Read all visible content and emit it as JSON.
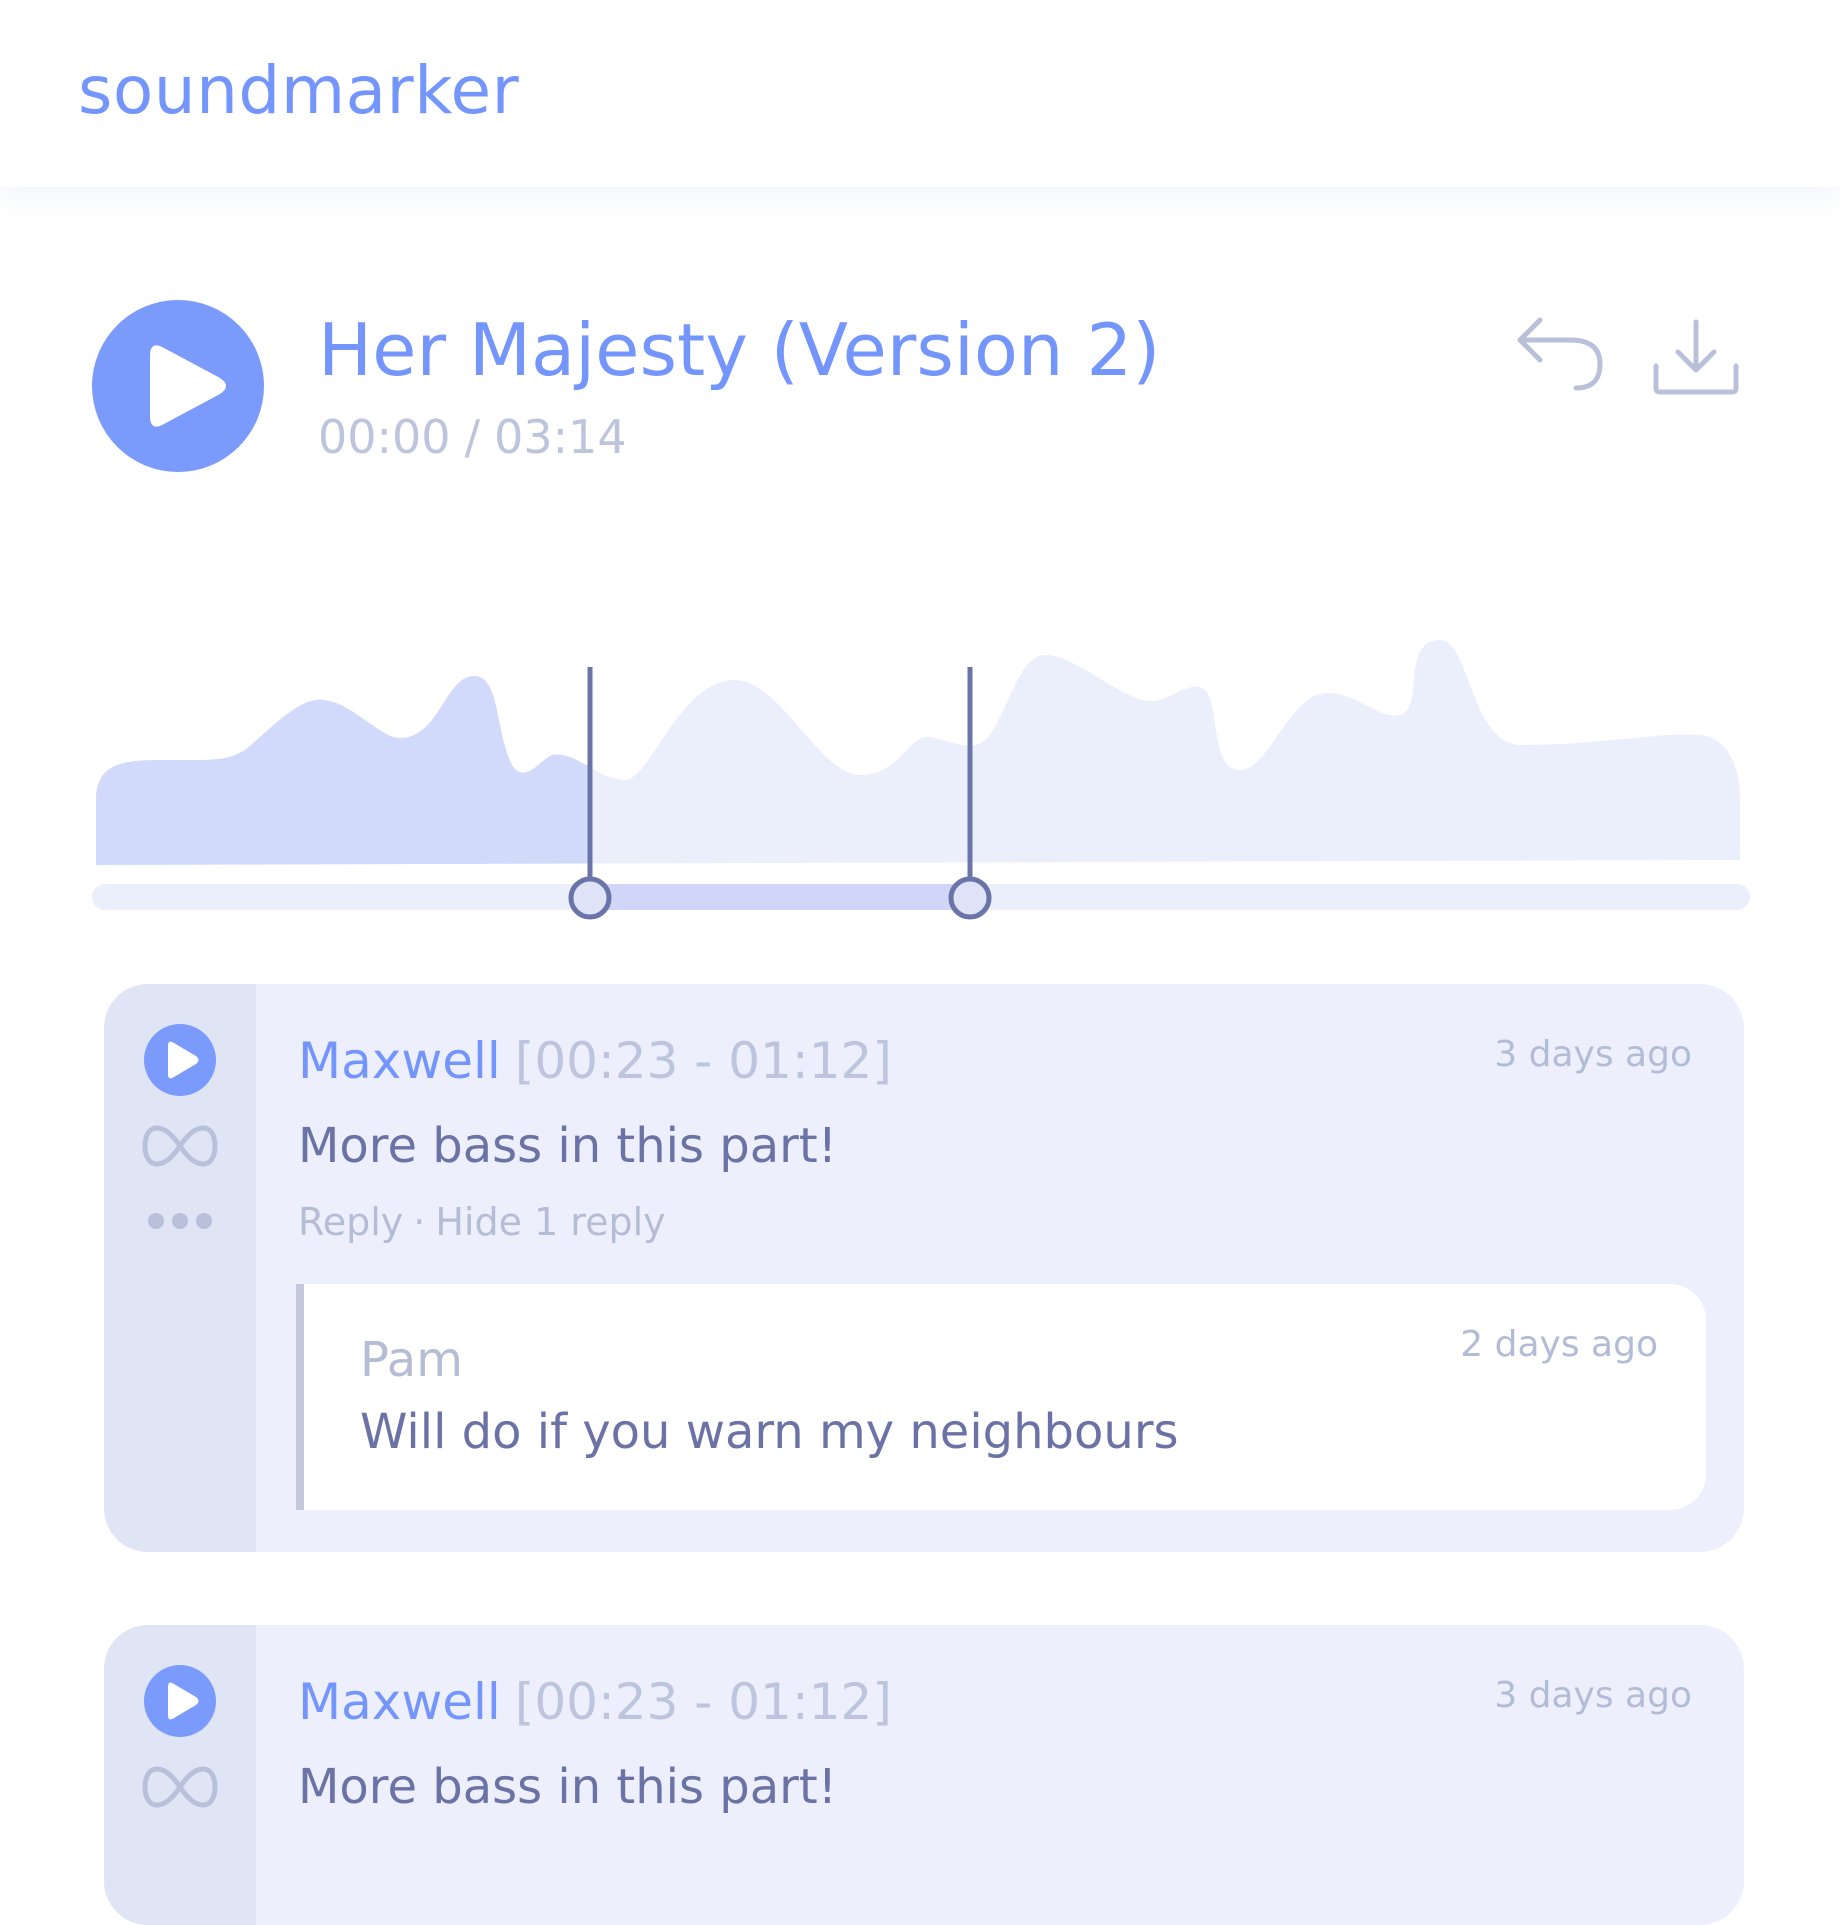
{
  "app": {
    "brand": "soundmarker"
  },
  "colors": {
    "accent": "#7496fc",
    "muted_text": "#bcc5dd",
    "body_text": "#6b72a6",
    "card_bg": "#edf0fc",
    "selection_handle": "#6b74a8"
  },
  "player": {
    "title": "Her Majesty (Version 2)",
    "current_time": "00:00",
    "separator": "/",
    "duration": "03:14",
    "play_icon": "play-icon",
    "reply_icon": "reply-arrow-icon",
    "download_icon": "download-icon",
    "waveform": {
      "selection_start": "00:23",
      "selection_end": "01:12",
      "played_fraction": 0
    }
  },
  "comments": [
    {
      "author": "Maxwell",
      "range": "[00:23 - 01:12]",
      "time_ago": "3 days ago",
      "text": "More bass in this part!",
      "reply_label": "Reply",
      "action_separator": "·",
      "hide_replies_label": "Hide 1 reply",
      "replies": [
        {
          "author": "Pam",
          "time_ago": "2 days ago",
          "text": "Will do if you warn my neighbours"
        }
      ]
    },
    {
      "author": "Maxwell",
      "range": "[00:23 - 01:12]",
      "time_ago": "3 days ago",
      "text": "More bass in this part!"
    }
  ]
}
